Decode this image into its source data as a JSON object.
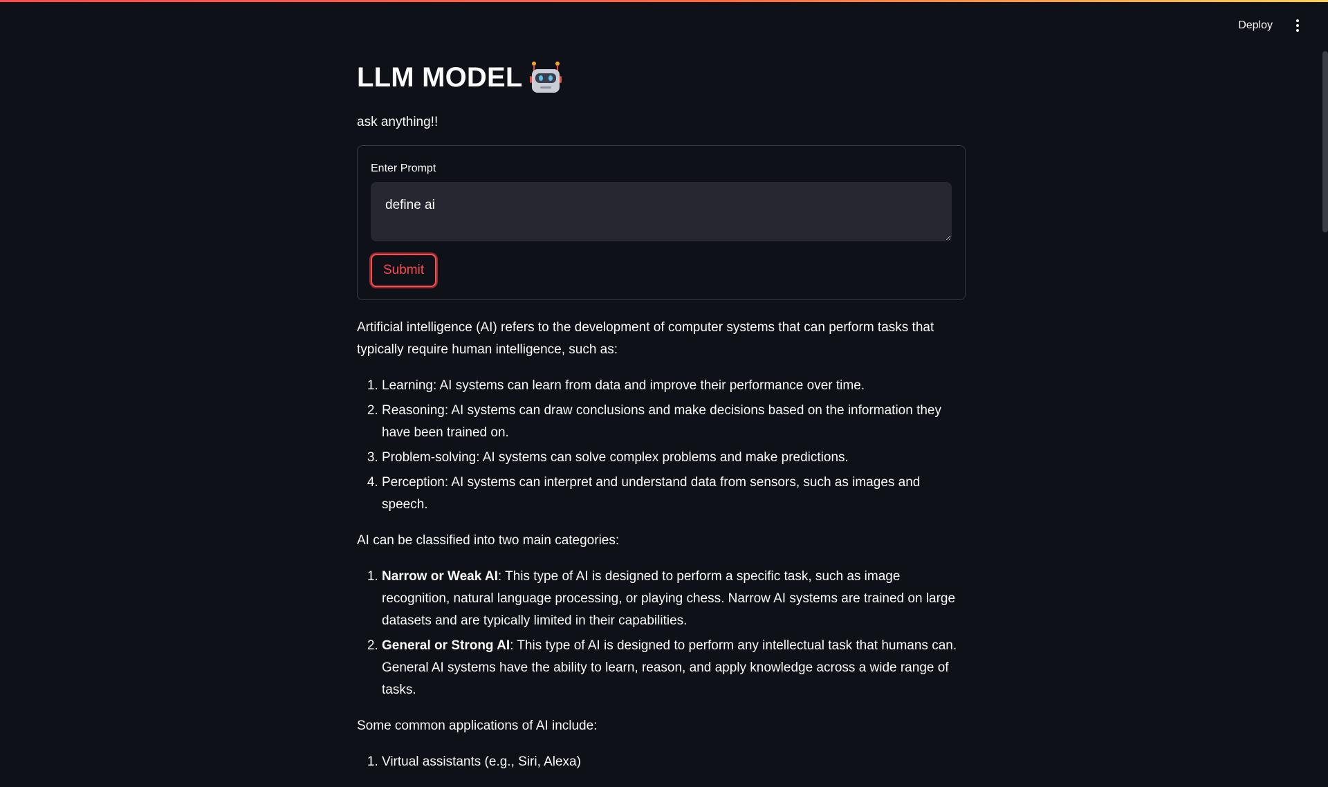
{
  "header": {
    "deploy_label": "Deploy",
    "menu_icon": "kebab-menu-icon"
  },
  "colors": {
    "background": "#0e1117",
    "accent": "#ff4b4b",
    "input_background": "#262730"
  },
  "page": {
    "title": "LLM MODEL",
    "title_icon": "robot-icon",
    "subtitle": "ask anything!!"
  },
  "form": {
    "label": "Enter Prompt",
    "prompt_value": "define ai",
    "submit_label": "Submit"
  },
  "response": {
    "intro": "Artificial intelligence (AI) refers to the development of computer systems that can perform tasks that typically require human intelligence, such as:",
    "capabilities": [
      "Learning: AI systems can learn from data and improve their performance over time.",
      "Reasoning: AI systems can draw conclusions and make decisions based on the information they have been trained on.",
      "Problem-solving: AI systems can solve complex problems and make predictions.",
      "Perception: AI systems can interpret and understand data from sensors, such as images and speech."
    ],
    "categories_intro": "AI can be classified into two main categories:",
    "categories": [
      {
        "term": "Narrow or Weak AI",
        "description": ": This type of AI is designed to perform a specific task, such as image recognition, natural language processing, or playing chess. Narrow AI systems are trained on large datasets and are typically limited in their capabilities."
      },
      {
        "term": "General or Strong AI",
        "description": ": This type of AI is designed to perform any intellectual task that humans can. General AI systems have the ability to learn, reason, and apply knowledge across a wide range of tasks."
      }
    ],
    "applications_intro": "Some common applications of AI include:",
    "applications": [
      "Virtual assistants (e.g., Siri, Alexa)"
    ]
  }
}
